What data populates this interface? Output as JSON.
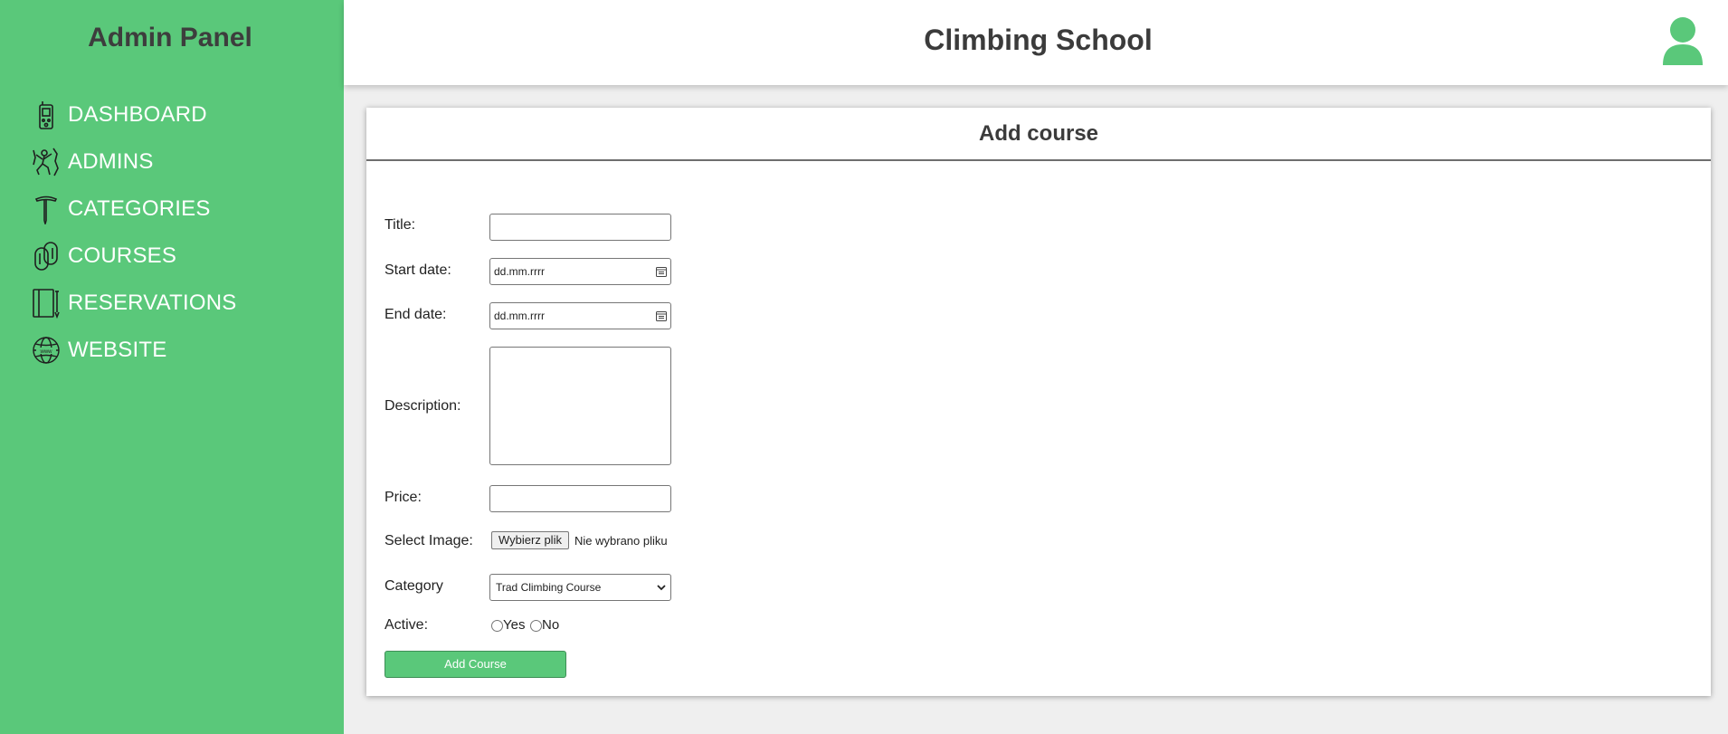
{
  "sidebar": {
    "title": "Admin Panel",
    "items": [
      {
        "label": "DASHBOARD",
        "icon": "gps-device-icon"
      },
      {
        "label": "ADMINS",
        "icon": "climber-icon"
      },
      {
        "label": "CATEGORIES",
        "icon": "ice-axe-icon"
      },
      {
        "label": "COURSES",
        "icon": "carabiner-icon"
      },
      {
        "label": "RESERVATIONS",
        "icon": "notebook-icon"
      },
      {
        "label": "WEBSITE",
        "icon": "globe-www-icon"
      }
    ]
  },
  "header": {
    "title": "Climbing School",
    "avatar_icon": "user-avatar-icon"
  },
  "form": {
    "title": "Add course",
    "labels": {
      "title": "Title:",
      "start_date": "Start date:",
      "end_date": "End date:",
      "description": "Description:",
      "price": "Price:",
      "image": "Select Image:",
      "category": "Category",
      "active": "Active:"
    },
    "values": {
      "title": "",
      "start_date": "dd.mm.rrrr",
      "end_date": "dd.mm.rrrr",
      "description": "",
      "price": ""
    },
    "file": {
      "button_label": "Wybierz plik",
      "status": "Nie wybrano pliku"
    },
    "category_selected": "Trad Climbing Course",
    "active_options": [
      "Yes",
      "No"
    ],
    "submit_label": "Add Course"
  },
  "colors": {
    "brand_green": "#5ac87a",
    "text_dark": "#3b3b3b",
    "background": "#efefef"
  }
}
